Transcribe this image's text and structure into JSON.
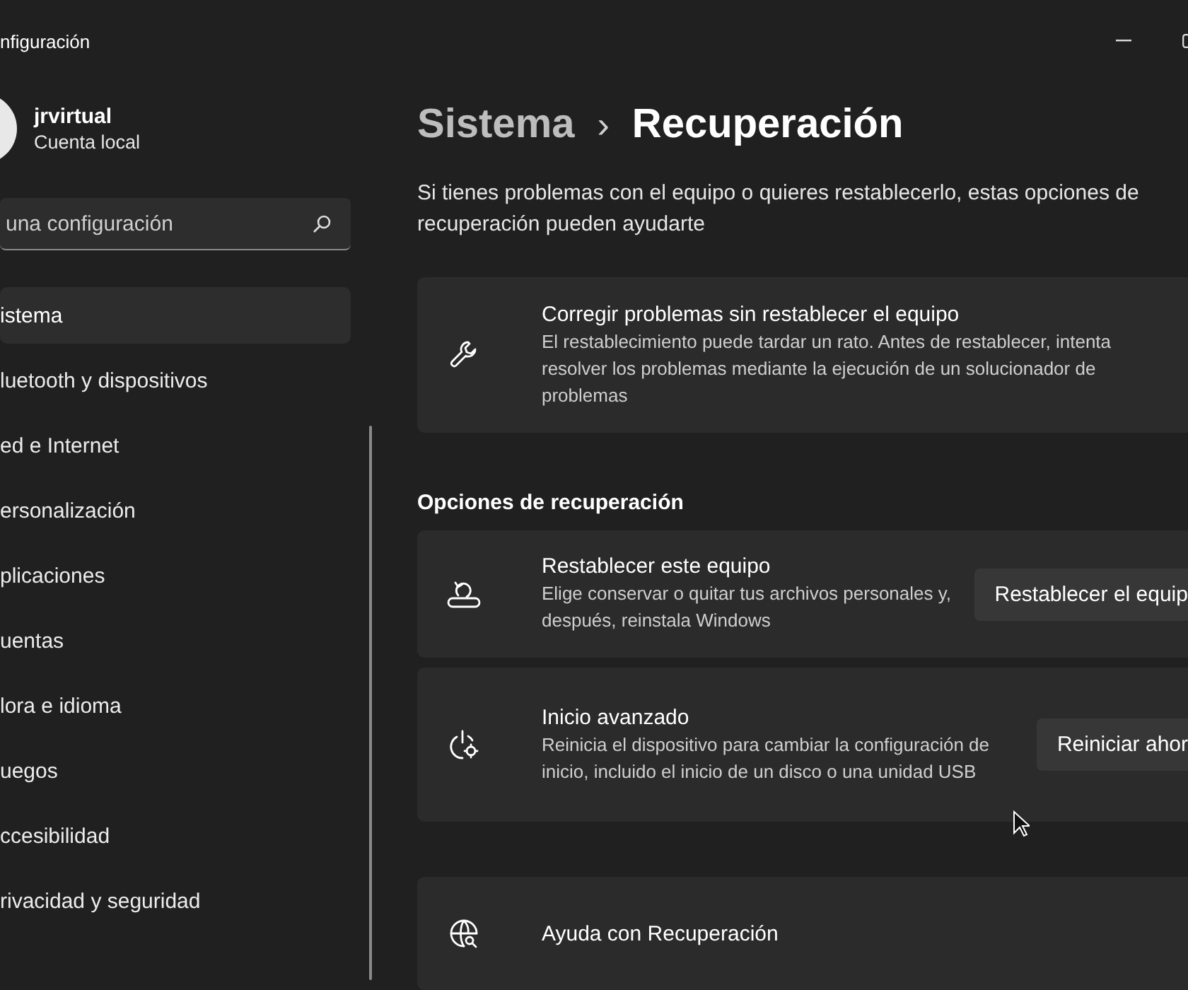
{
  "window": {
    "title": "nfiguración"
  },
  "user": {
    "name": "jrvirtual",
    "account": "Cuenta local"
  },
  "search": {
    "placeholder": "una configuración"
  },
  "sidebar": {
    "items": [
      {
        "label": "istema",
        "selected": true
      },
      {
        "label": "luetooth y dispositivos",
        "selected": false
      },
      {
        "label": "ed e Internet",
        "selected": false
      },
      {
        "label": "ersonalización",
        "selected": false
      },
      {
        "label": "plicaciones",
        "selected": false
      },
      {
        "label": "uentas",
        "selected": false
      },
      {
        "label": "lora e idioma",
        "selected": false
      },
      {
        "label": "uegos",
        "selected": false
      },
      {
        "label": "ccesibilidad",
        "selected": false
      },
      {
        "label": "rivacidad y seguridad",
        "selected": false
      }
    ]
  },
  "breadcrumb": {
    "parent": "Sistema",
    "separator": "›",
    "current": "Recuperación"
  },
  "description": "Si tienes problemas con el equipo o quieres restablecerlo, estas opciones de recuperación pueden ayudarte",
  "fix_card": {
    "kind": "wrench",
    "title": "Corregir problemas sin restablecer el equipo",
    "description": "El restablecimiento puede tardar un rato. Antes de restablecer, intenta resolver los problemas mediante la ejecución de un solucionador de problemas"
  },
  "section_title": "Opciones de recuperación",
  "options": [
    {
      "kind": "reset",
      "title": "Restablecer este equipo",
      "description": "Elige conservar o quitar tus archivos personales y, después, reinstala Windows",
      "button": "Restablecer el equip"
    },
    {
      "kind": "power",
      "title": "Inicio avanzado",
      "description": "Reinicia el dispositivo para cambiar la configuración de inicio, incluido el inicio de un disco o una unidad USB",
      "button": "Reiniciar ahor"
    }
  ],
  "help": {
    "kind": "globe",
    "title": "Ayuda con Recuperación"
  }
}
